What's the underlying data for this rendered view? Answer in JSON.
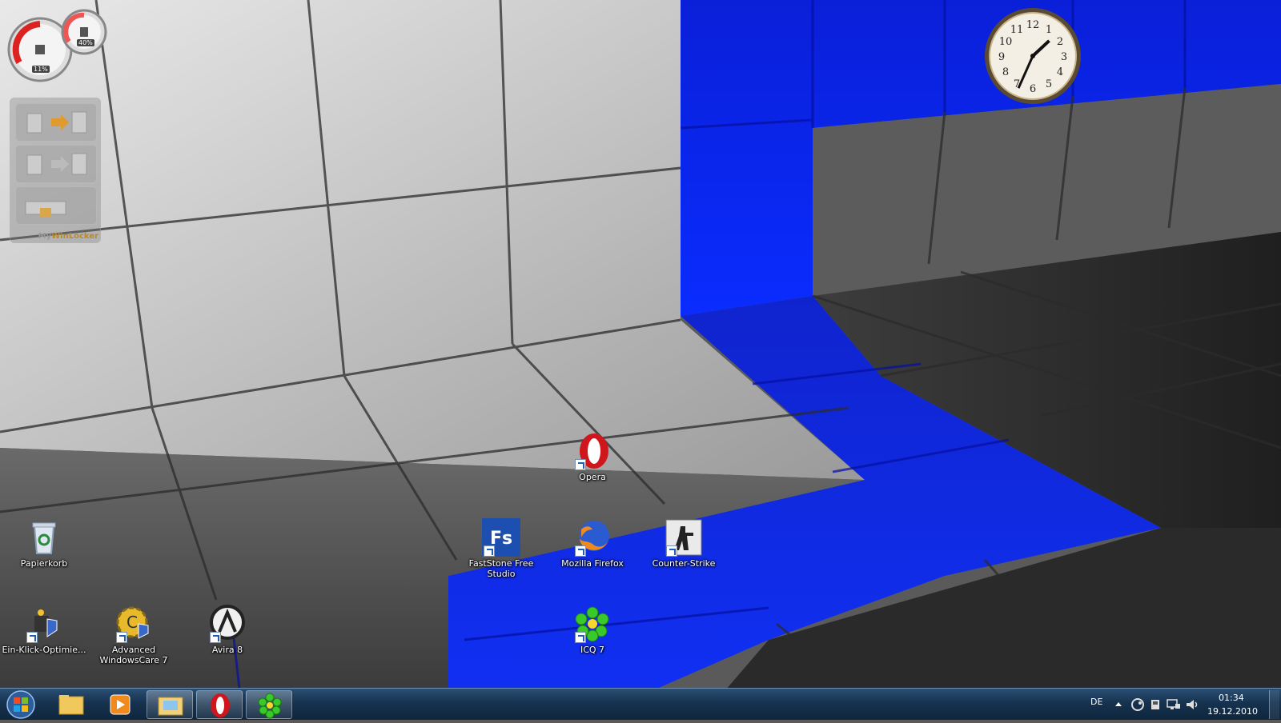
{
  "desktop": {
    "icons": [
      {
        "name": "recycle-bin",
        "label": "Papierkorb"
      },
      {
        "name": "ein-klick-optimierer",
        "label": "Ein-Klick-Optimie..."
      },
      {
        "name": "advanced-systemcare",
        "label": "Advanced WindowsCare 7"
      },
      {
        "name": "avira",
        "label": "Avira 8"
      },
      {
        "name": "opera",
        "label": "Opera"
      },
      {
        "name": "faststone",
        "label": "FastStone Free Studio"
      },
      {
        "name": "firefox",
        "label": "Mozilla Firefox"
      },
      {
        "name": "counter-strike",
        "label": "Counter-Strike"
      },
      {
        "name": "icq",
        "label": "ICQ 7"
      }
    ]
  },
  "gadgets": {
    "cpu_meter": {
      "cpu_percent": "11%",
      "ram_percent": "40%"
    },
    "mywinlocker": {
      "brand_my": "My",
      "brand_win": "WinLocker"
    },
    "clock": {
      "hour": 1,
      "minute": 34
    }
  },
  "taskbar": {
    "items": [
      {
        "name": "explorer",
        "active": false
      },
      {
        "name": "media-player",
        "active": false
      },
      {
        "name": "windows-explorer-folder",
        "active": true
      },
      {
        "name": "opera",
        "active": true
      },
      {
        "name": "icq",
        "active": true
      }
    ],
    "tray": {
      "language": "DE",
      "time": "01:34",
      "date": "19.12.2010"
    }
  },
  "colors": {
    "accent_blue": "#1a3cff",
    "taskbar": "#16324f"
  }
}
